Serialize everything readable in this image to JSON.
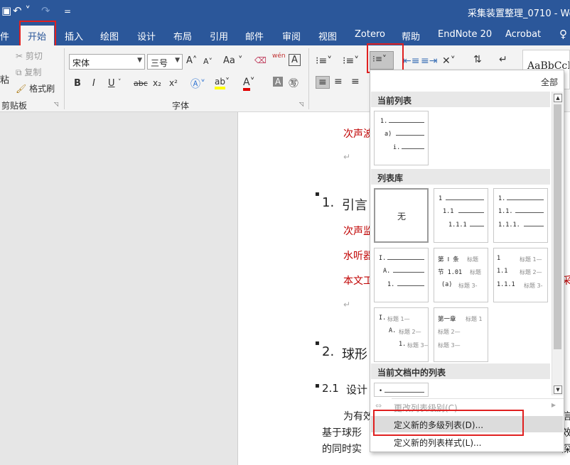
{
  "titlebar": {
    "doc_title": "采集装置整理_0710  -  Wo",
    "undo_glyph": "↶ ˅",
    "redo_glyph": "↷",
    "customize_glyph": "="
  },
  "tabs": [
    "件",
    "开始",
    "插入",
    "绘图",
    "设计",
    "布局",
    "引用",
    "邮件",
    "审阅",
    "视图",
    "Zotero",
    "帮助",
    "EndNote 20",
    "Acrobat"
  ],
  "ribbon": {
    "clipboard": {
      "paste": "粘",
      "cut": "剪切",
      "copy": "复制",
      "format_painter": "格式刷",
      "group_label": "剪贴板"
    },
    "font": {
      "font_name": "宋体",
      "font_size": "三号",
      "grow": "A˄",
      "shrink": "A˅",
      "case": "Aa ˅",
      "wen": "wén",
      "bold": "B",
      "italic": "I",
      "underline": "U",
      "strike": "abc",
      "sub": "x₂",
      "sup": "x²",
      "group_label": "字体"
    },
    "styles": {
      "preview": "AaBbCcI"
    }
  },
  "document": {
    "line1": "次声波",
    "heading1_num": "1.",
    "heading1": "引言",
    "red1": "次声监",
    "red2": "水听器",
    "red3": "本文工",
    "heading2_num": "2.",
    "heading2": "球形",
    "heading21_num": "2.1",
    "heading21": "设计",
    "para1": "为有效",
    "para2": "基于球形",
    "para3": "的同时实",
    "right_chars": [
      "信",
      "效",
      "深",
      "采"
    ]
  },
  "multilevel_list": {
    "all_label": "全部",
    "current_list_header": "当前列表",
    "library_header": "列表库",
    "in_doc_header": "当前文档中的列表",
    "none_label": "无",
    "current_levels": [
      "1.",
      "a)",
      "i."
    ],
    "lib1_levels": [
      "1",
      "1.1",
      "1.1.1"
    ],
    "lib2_levels": [
      "1.",
      "1.1.",
      "1.1.1."
    ],
    "lib3_levels": [
      "I.",
      "A.",
      "1."
    ],
    "lib4_levels": [
      "第 Ⅰ 条",
      "节 1.01",
      "(a)"
    ],
    "lib4_suffix": [
      "标题",
      "标题",
      "标题 3-"
    ],
    "lib5_levels": [
      "1",
      "1.1",
      "1.1.1"
    ],
    "lib5_suffix": [
      "标题 1—",
      "标题 2—",
      "标题 3-"
    ],
    "lib6_levels": [
      "I.",
      "A.",
      "1."
    ],
    "lib6_suffix": [
      "标题 1—",
      "标题 2—",
      "标题 3—"
    ],
    "lib7_levels": [
      "第一章",
      "标题 2—",
      "标题 3—"
    ],
    "lib7_suffix": "标题 1",
    "doc_level": "•",
    "menu": {
      "change_level": "更改列表级别(C)",
      "define_multilevel": "定义新的多级列表(D)...",
      "define_style": "定义新的列表样式(L)..."
    }
  },
  "colors": {
    "word_blue": "#2b579a",
    "highlight_red": "#e02020",
    "doc_red": "#c00000"
  }
}
